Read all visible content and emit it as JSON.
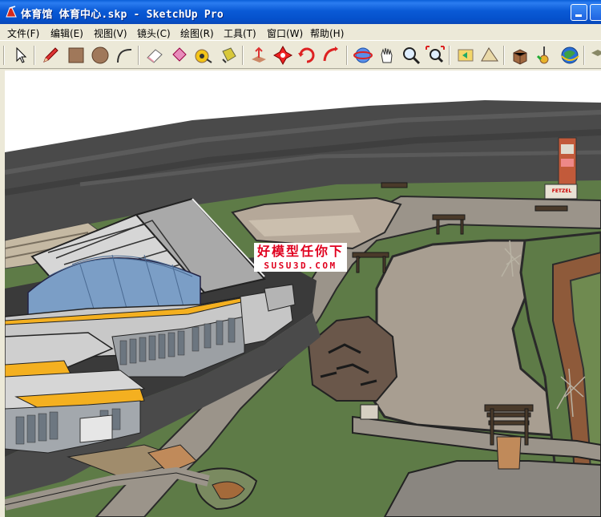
{
  "window": {
    "title": "体育馆 体育中心.skp - SketchUp Pro"
  },
  "menu": [
    {
      "label": "文件(F)"
    },
    {
      "label": "编辑(E)"
    },
    {
      "label": "视图(V)"
    },
    {
      "label": "镜头(C)"
    },
    {
      "label": "绘图(R)"
    },
    {
      "label": "工具(T)"
    },
    {
      "label": "窗口(W)"
    },
    {
      "label": "帮助(H)"
    }
  ],
  "toolbar": {
    "tools": [
      "select-icon",
      "pencil-icon",
      "rectangle-icon",
      "circle-icon",
      "arc-icon",
      "eraser-icon",
      "paint-bucket-icon",
      "tape-measure-icon",
      "paint-icon",
      "push-pull-icon",
      "move-icon",
      "rotate-icon",
      "follow-me-icon",
      "orbit-icon",
      "pan-icon",
      "zoom-icon",
      "zoom-extents-icon",
      "previous-view-icon",
      "next-view-icon",
      "component-icon",
      "position-camera-icon",
      "google-earth-icon",
      "more-icon"
    ]
  },
  "viewport": {
    "watermark": {
      "line1": "好模型任你下",
      "line2": "SUSU3D.COM"
    },
    "sign_text": "FETZEL"
  },
  "colors": {
    "title_bar": "#0a5ad6",
    "chrome": "#ece9d8",
    "watermark": "#e0001e",
    "grass": "#5c7a46",
    "path": "#a29a90",
    "sky": "#555555"
  }
}
